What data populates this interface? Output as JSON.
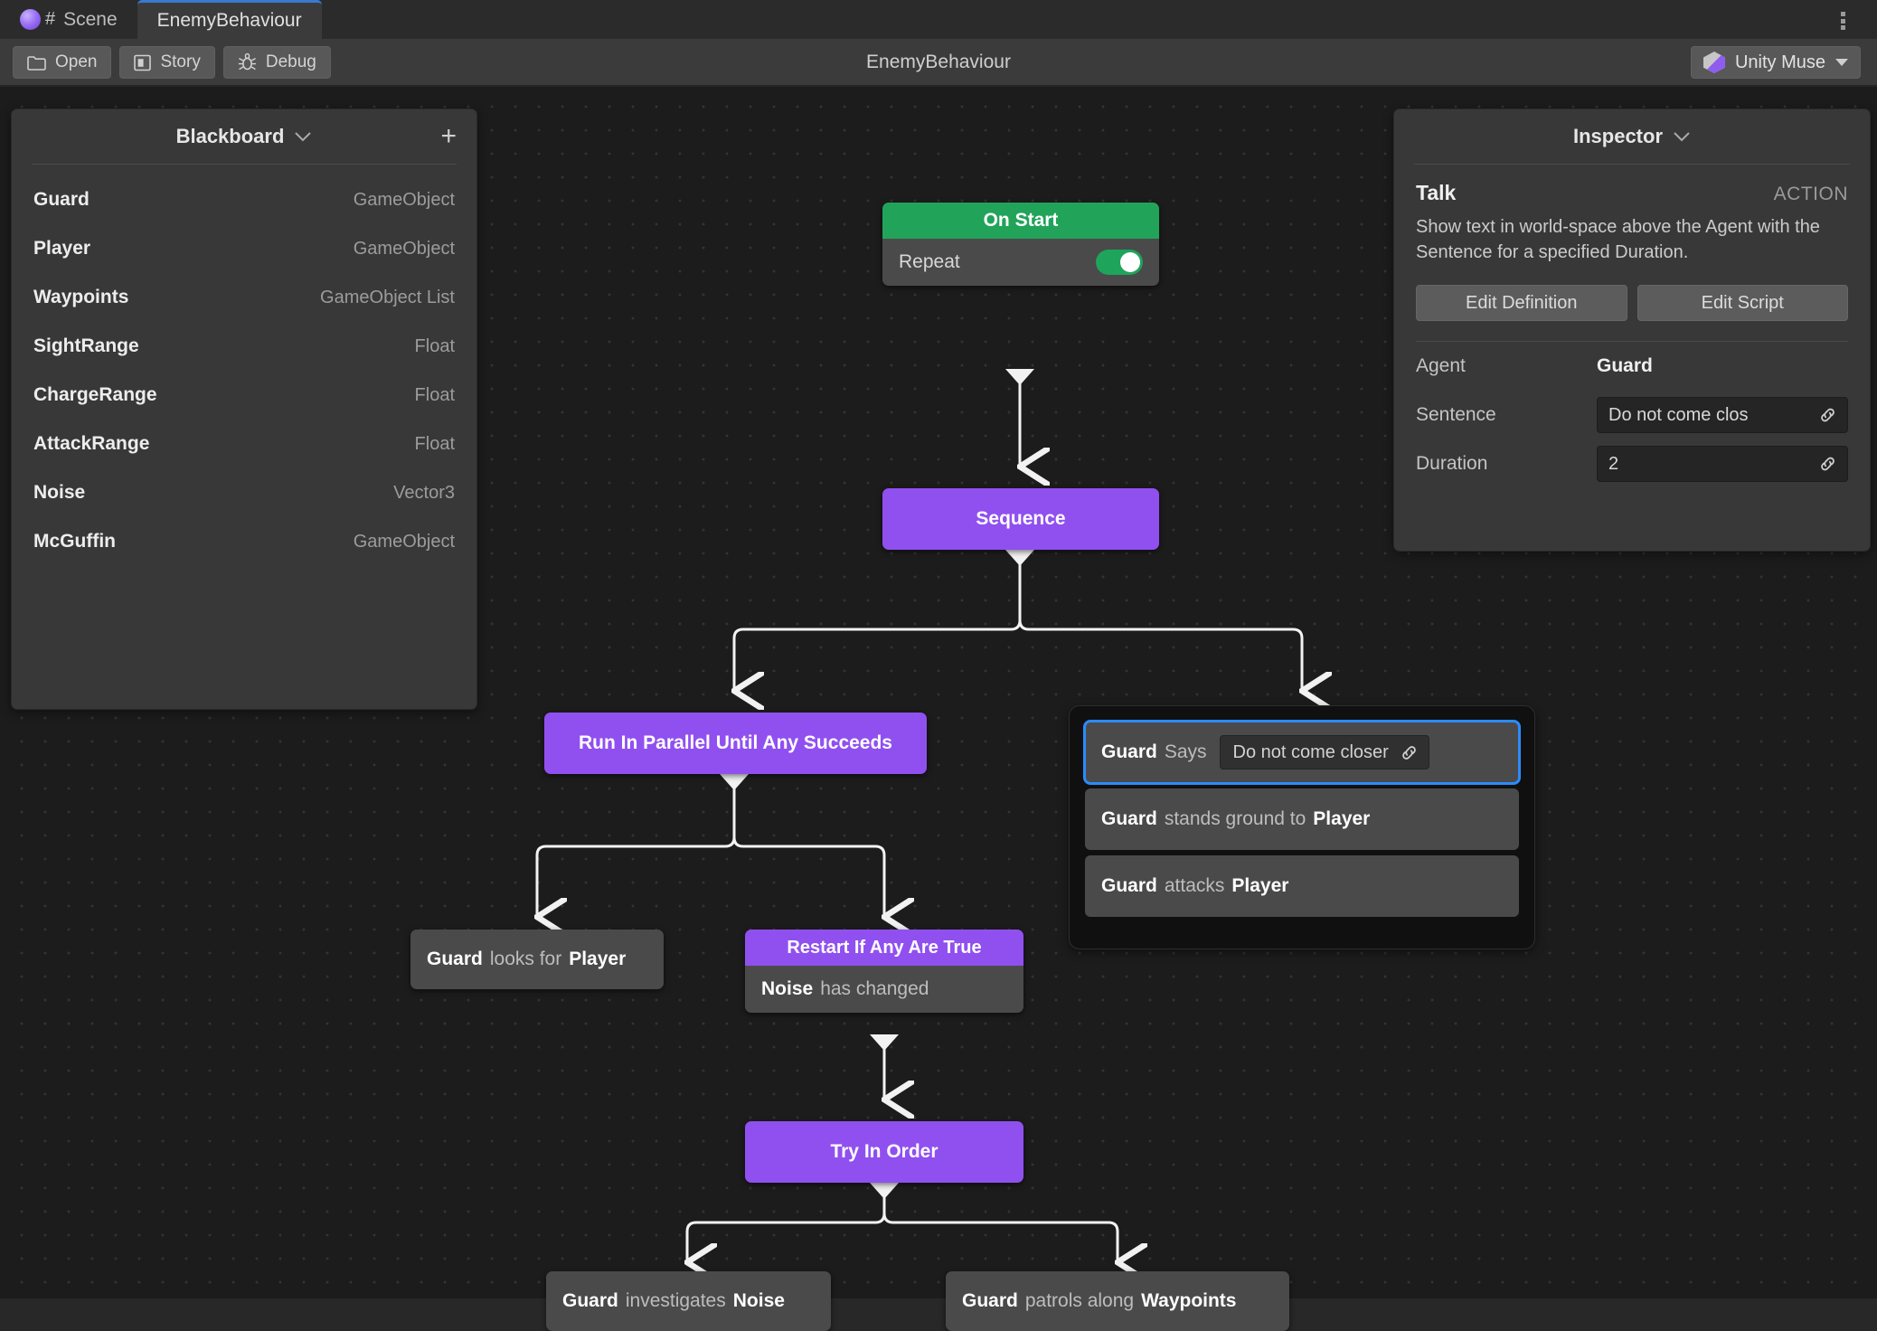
{
  "window": {
    "tabs": [
      {
        "label": "Scene",
        "icon": "unity-logo-icon",
        "active": false
      },
      {
        "label": "EnemyBehaviour",
        "icon": "",
        "active": true
      }
    ],
    "overflow_menu_icon": "kebab-menu-icon"
  },
  "toolbar": {
    "open_label": "Open",
    "open_icon": "folder-icon",
    "story_label": "Story",
    "story_icon": "story-panel-icon",
    "debug_label": "Debug",
    "debug_icon": "bug-icon",
    "title": "EnemyBehaviour",
    "muse_label": "Unity Muse",
    "muse_icon": "muse-cube-icon",
    "muse_caret_icon": "caret-down-icon"
  },
  "blackboard": {
    "title": "Blackboard",
    "collapse_icon": "chevron-down-icon",
    "add_icon": "plus-icon",
    "variables": [
      {
        "name": "Guard",
        "type": "GameObject"
      },
      {
        "name": "Player",
        "type": "GameObject"
      },
      {
        "name": "Waypoints",
        "type": "GameObject List"
      },
      {
        "name": "SightRange",
        "type": "Float"
      },
      {
        "name": "ChargeRange",
        "type": "Float"
      },
      {
        "name": "AttackRange",
        "type": "Float"
      },
      {
        "name": "Noise",
        "type": "Vector3"
      },
      {
        "name": "McGuffin",
        "type": "GameObject"
      }
    ]
  },
  "inspector": {
    "title": "Inspector",
    "collapse_icon": "chevron-down-icon",
    "node_name": "Talk",
    "node_kind": "ACTION",
    "description": "Show text in world-space above the Agent with the Sentence for a specified Duration.",
    "edit_definition_label": "Edit Definition",
    "edit_script_label": "Edit Script",
    "fields": [
      {
        "label": "Agent",
        "value": "Guard",
        "kind": "reference",
        "link_icon": ""
      },
      {
        "label": "Sentence",
        "value": "Do not come clos",
        "kind": "input",
        "link_icon": "link-icon"
      },
      {
        "label": "Duration",
        "value": "2",
        "kind": "input",
        "link_icon": "link-icon"
      }
    ]
  },
  "graph": {
    "nodes": {
      "on_start": {
        "title": "On Start",
        "field_label": "Repeat",
        "toggle_on": true
      },
      "sequence": {
        "title": "Sequence"
      },
      "parallel": {
        "title": "Run In Parallel Until Any Succeeds"
      },
      "looks_for": {
        "agent": "Guard",
        "verb": "looks for",
        "target": "Player"
      },
      "restart": {
        "title": "Restart If Any Are True",
        "condition_var": "Noise",
        "condition_text": "has changed"
      },
      "try_in_order": {
        "title": "Try In Order"
      },
      "investigates": {
        "agent": "Guard",
        "verb": "investigates",
        "target": "Noise"
      },
      "patrols": {
        "agent": "Guard",
        "verb": "patrols along",
        "target": "Waypoints"
      },
      "says": {
        "agent": "Guard",
        "verb": "Says",
        "value": "Do not come closer",
        "link_icon": "link-icon",
        "selected": true
      },
      "stands": {
        "agent": "Guard",
        "verb": "stands ground to",
        "target": "Player"
      },
      "attacks": {
        "agent": "Guard",
        "verb": "attacks",
        "target": "Player"
      }
    }
  },
  "colors": {
    "flow_node": "#9050f0",
    "event_node": "#22a35a",
    "action_node": "#4a4a4a",
    "selection": "#2b8bff",
    "toggle_on": "#1ea45b",
    "canvas": "#1c1c1c"
  }
}
